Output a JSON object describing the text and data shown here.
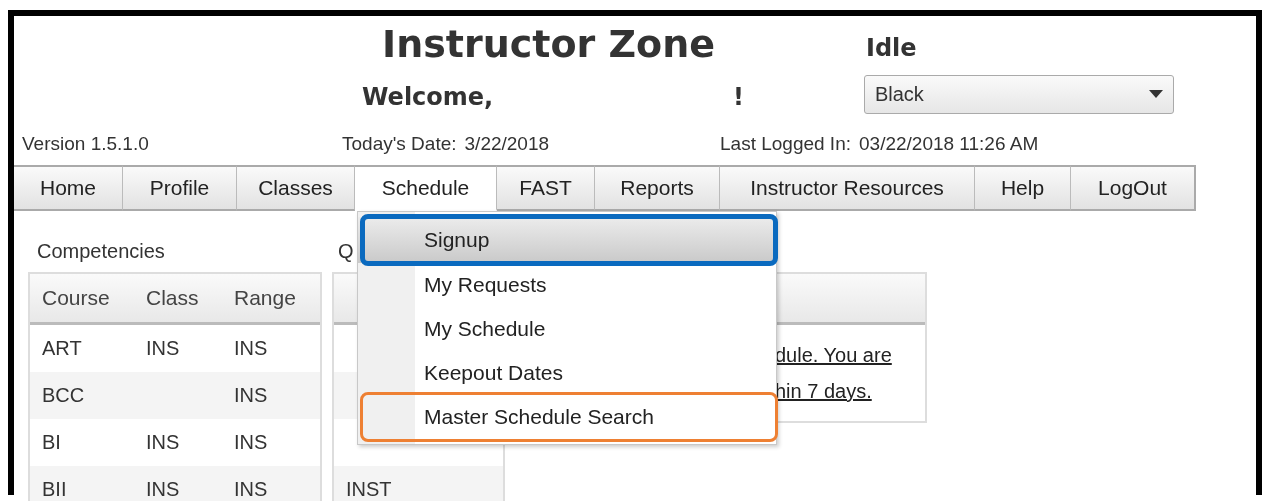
{
  "header": {
    "title": "Instructor Zone",
    "status": "Idle",
    "welcome": "Welcome,",
    "exclamation": "!",
    "theme_select": {
      "value": "Black"
    },
    "version": "Version 1.5.1.0",
    "todays_date_label": "Today's Date:",
    "todays_date": "3/22/2018",
    "last_logged_label": "Last Logged In:",
    "last_logged": "03/22/2018 11:26 AM"
  },
  "nav": [
    {
      "label": "Home",
      "selected": false
    },
    {
      "label": "Profile",
      "selected": false
    },
    {
      "label": "Classes",
      "selected": false
    },
    {
      "label": "Schedule",
      "selected": true
    },
    {
      "label": "FAST",
      "selected": false
    },
    {
      "label": "Reports",
      "selected": false
    },
    {
      "label": "Instructor Resources",
      "selected": false
    },
    {
      "label": "Help",
      "selected": false
    },
    {
      "label": "LogOut",
      "selected": false
    }
  ],
  "competencies": {
    "title": "Competencies",
    "columns": [
      "Course",
      "Class",
      "Range"
    ],
    "rows": [
      [
        "ART",
        "INS",
        "INS"
      ],
      [
        "BCC",
        "",
        "INS"
      ],
      [
        "BI",
        "INS",
        "INS"
      ],
      [
        "BII",
        "INS",
        "INS"
      ]
    ]
  },
  "panel_2": {
    "title": "Q",
    "rows": [
      "",
      "",
      "",
      "INST"
    ]
  },
  "panel_3": {
    "lines": [
      "dule. You are",
      "hin 7 days."
    ]
  },
  "schedule_menu": {
    "items": [
      {
        "label": "Signup",
        "selected": true,
        "color": "#0a6abf"
      },
      {
        "label": "My Requests",
        "selected": false
      },
      {
        "label": "My Schedule",
        "selected": false
      },
      {
        "label": "Keepout Dates",
        "selected": false
      },
      {
        "label": "Master Schedule Search",
        "selected": false,
        "color": "#ee8033"
      }
    ]
  }
}
